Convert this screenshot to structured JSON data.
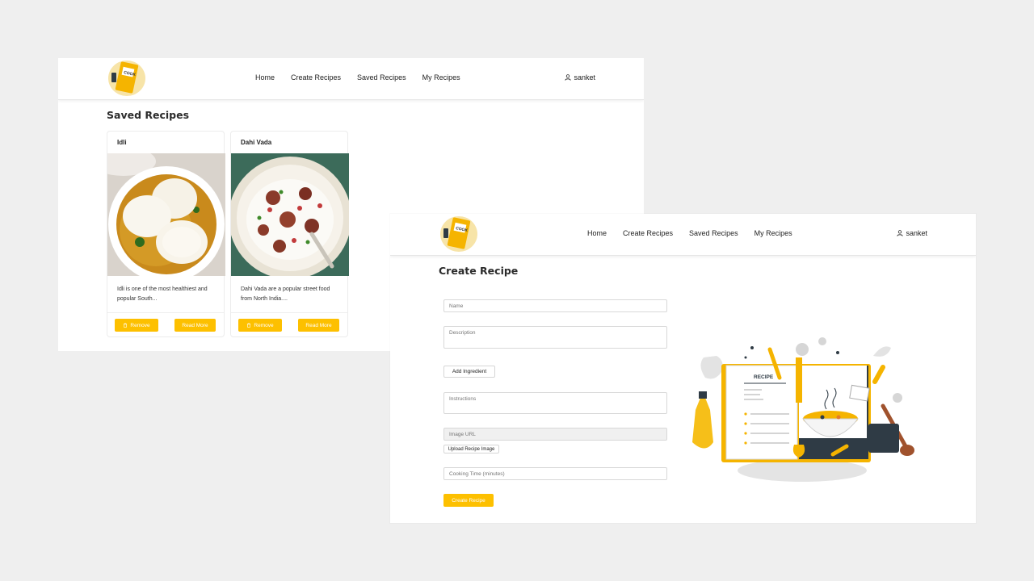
{
  "nav": {
    "links": [
      "Home",
      "Create Recipes",
      "Saved Recipes",
      "My Recipes"
    ],
    "username": "sanket"
  },
  "saved_page": {
    "title": "Saved Recipes",
    "cards": [
      {
        "title": "Idli",
        "description": "Idli is one of the most healthiest and popular South...",
        "remove_label": "Remove",
        "read_more_label": "Read More"
      },
      {
        "title": "Dahi Vada",
        "description": "Dahi Vada are a popular street food from North India....",
        "remove_label": "Remove",
        "read_more_label": "Read More"
      }
    ]
  },
  "create_page": {
    "title": "Create Recipe",
    "name_placeholder": "Name",
    "description_placeholder": "Description",
    "add_ingredient_label": "Add Ingredient",
    "instructions_placeholder": "Instructions",
    "image_url_placeholder": "Image URL",
    "upload_label": "Upload Recipe Image",
    "cooking_time_placeholder": "Cooking Time (minutes)",
    "submit_label": "Create Recipe",
    "illustration_text": "RECIPE"
  },
  "colors": {
    "accent": "#fdc000",
    "background": "#efefef",
    "dark": "#2f3b45"
  },
  "icons": [
    "logo-icon",
    "user-icon",
    "trash-icon"
  ]
}
